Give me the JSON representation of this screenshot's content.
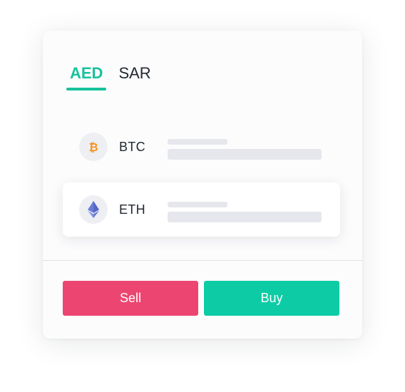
{
  "tabs": [
    {
      "label": "AED",
      "active": true
    },
    {
      "label": "SAR",
      "active": false
    }
  ],
  "coins": [
    {
      "symbol": "BTC",
      "icon": "bitcoin-icon",
      "icon_color": "#f7931a"
    },
    {
      "symbol": "ETH",
      "icon": "ethereum-icon",
      "icon_color": "#6a7dd8"
    }
  ],
  "actions": {
    "sell_label": "Sell",
    "buy_label": "Buy"
  },
  "colors": {
    "accent": "#18c29c",
    "sell": "#ed4571",
    "buy": "#0dcca5"
  }
}
